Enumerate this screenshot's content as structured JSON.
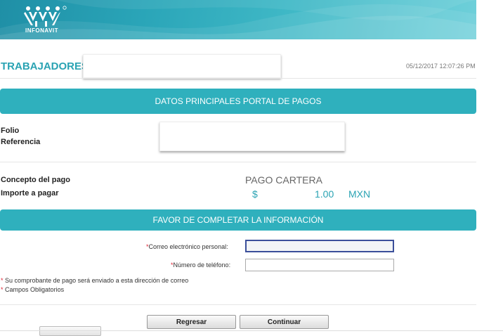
{
  "header": {
    "brand": "INFONAVIT",
    "colors": {
      "gradient_start": "#1f8fa6",
      "gradient_end": "#6fd0da"
    }
  },
  "workers": {
    "label": "TRABAJADORES:",
    "value": ""
  },
  "datetime": "05/12/2017 12:07:26 PM",
  "section1": {
    "title": "DATOS PRINCIPALES PORTAL DE PAGOS"
  },
  "folio": {
    "label": "Folio",
    "value": ""
  },
  "referencia": {
    "label": "Referencia",
    "value": ""
  },
  "concepto": {
    "label": "Concepto del pago",
    "value": "PAGO CARTERA"
  },
  "importe": {
    "label": "Importe a pagar",
    "currency_symbol": "$",
    "amount": "1.00",
    "currency": "MXN"
  },
  "section2": {
    "title": "FAVOR DE COMPLETAR LA INFORMACIÓN"
  },
  "form": {
    "email": {
      "required_mark": "*",
      "label": "Correo electrónico personal:",
      "value": "",
      "placeholder": ""
    },
    "phone": {
      "required_mark": "*",
      "label": "Número de teléfono:",
      "value": "",
      "placeholder": ""
    }
  },
  "notes": [
    {
      "mark": "*",
      "text": "Su comprobante de pago será enviado a esta dirección de correo"
    },
    {
      "mark": "*",
      "text": "Campos Obligatorios"
    }
  ],
  "buttons": {
    "back": "Regresar",
    "continue": "Continuar"
  },
  "accent_color": "#2fb0bd"
}
